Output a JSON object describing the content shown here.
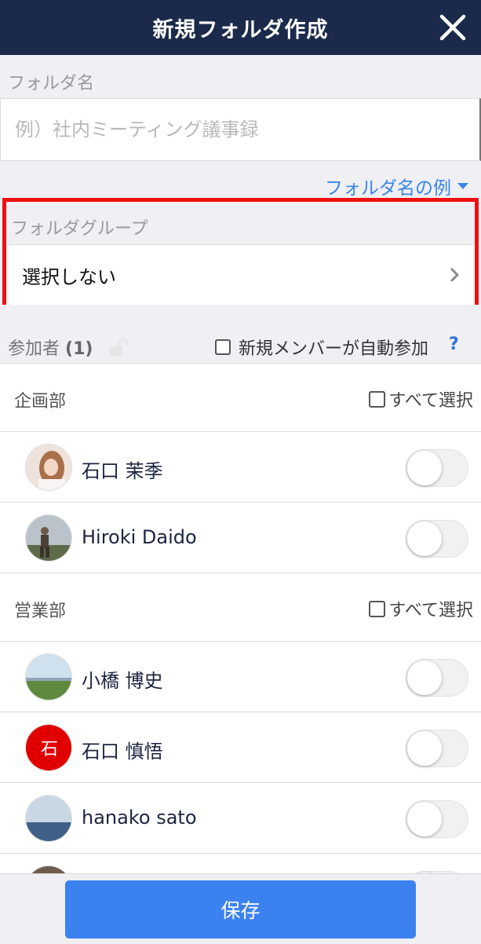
{
  "header": {
    "title": "新規フォルダ作成"
  },
  "folder_name": {
    "label": "フォルダ名",
    "placeholder": "例）社内ミーティング議事録",
    "value": "",
    "example_link": "フォルダ名の例"
  },
  "folder_group": {
    "label": "フォルダグループ",
    "value": "選択しない"
  },
  "participants": {
    "label": "参加者",
    "count": "(1)",
    "auto_join_label": "新規メンバーが自動参加",
    "help": "?"
  },
  "departments": [
    {
      "name": "企画部",
      "select_all": "すべて選択",
      "members": [
        {
          "name": "石口 茉季",
          "on": false
        },
        {
          "name": "Hiroki Daido",
          "on": false
        }
      ]
    },
    {
      "name": "営業部",
      "select_all": "すべて選択",
      "members": [
        {
          "name": "小橋 博史",
          "on": false
        },
        {
          "name": "石口 慎悟",
          "on": false,
          "avatar_text": "石"
        },
        {
          "name": "hanako sato",
          "on": false
        }
      ]
    }
  ],
  "colors": {
    "header": "#1b2a4a",
    "accent": "#3b82f0",
    "highlight": "#ee1010"
  },
  "footer": {
    "save_label": "保存"
  }
}
